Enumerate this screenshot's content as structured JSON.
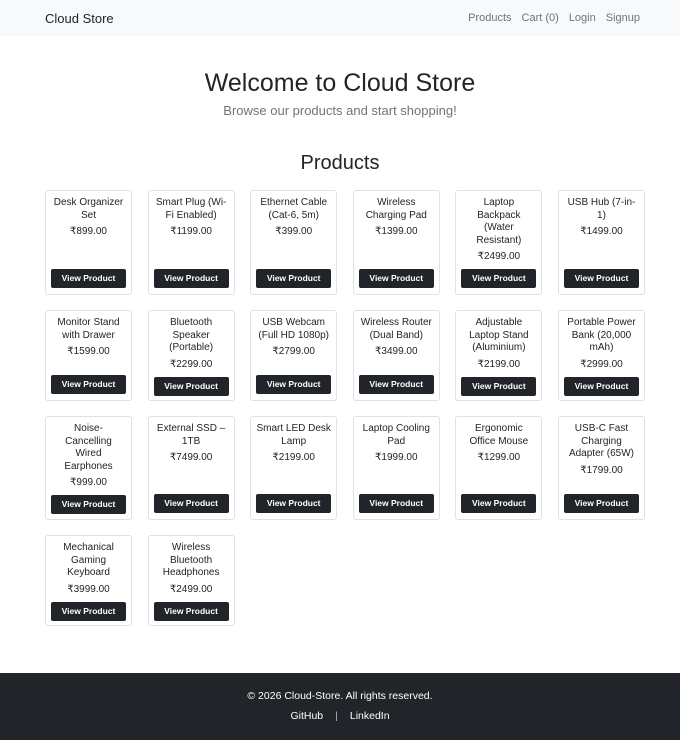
{
  "navbar": {
    "brand": "Cloud Store",
    "links": [
      "Products",
      "Cart (0)",
      "Login",
      "Signup"
    ]
  },
  "hero": {
    "title": "Welcome to Cloud Store",
    "subtitle": "Browse our products and start shopping!"
  },
  "products_section": {
    "title": "Products",
    "button_label": "View Product",
    "items": [
      {
        "name": "Desk Organizer Set",
        "price": "₹899.00"
      },
      {
        "name": "Smart Plug (Wi-Fi Enabled)",
        "price": "₹1199.00"
      },
      {
        "name": "Ethernet Cable (Cat-6, 5m)",
        "price": "₹399.00"
      },
      {
        "name": "Wireless Charging Pad",
        "price": "₹1399.00"
      },
      {
        "name": "Laptop Backpack (Water Resistant)",
        "price": "₹2499.00"
      },
      {
        "name": "USB Hub (7-in-1)",
        "price": "₹1499.00"
      },
      {
        "name": "Monitor Stand with Drawer",
        "price": "₹1599.00"
      },
      {
        "name": "Bluetooth Speaker (Portable)",
        "price": "₹2299.00"
      },
      {
        "name": "USB Webcam (Full HD 1080p)",
        "price": "₹2799.00"
      },
      {
        "name": "Wireless Router (Dual Band)",
        "price": "₹3499.00"
      },
      {
        "name": "Adjustable Laptop Stand (Aluminium)",
        "price": "₹2199.00"
      },
      {
        "name": "Portable Power Bank (20,000 mAh)",
        "price": "₹2999.00"
      },
      {
        "name": "Noise-Cancelling Wired Earphones",
        "price": "₹999.00"
      },
      {
        "name": "External SSD – 1TB",
        "price": "₹7499.00"
      },
      {
        "name": "Smart LED Desk Lamp",
        "price": "₹2199.00"
      },
      {
        "name": "Laptop Cooling Pad",
        "price": "₹1999.00"
      },
      {
        "name": "Ergonomic Office Mouse",
        "price": "₹1299.00"
      },
      {
        "name": "USB-C Fast Charging Adapter (65W)",
        "price": "₹1799.00"
      },
      {
        "name": "Mechanical Gaming Keyboard",
        "price": "₹3999.00"
      },
      {
        "name": "Wireless Bluetooth Headphones",
        "price": "₹2499.00"
      }
    ]
  },
  "footer": {
    "copyright": "© 2026 Cloud-Store. All rights reserved.",
    "links": [
      "GitHub",
      "LinkedIn"
    ],
    "separator": "|"
  }
}
